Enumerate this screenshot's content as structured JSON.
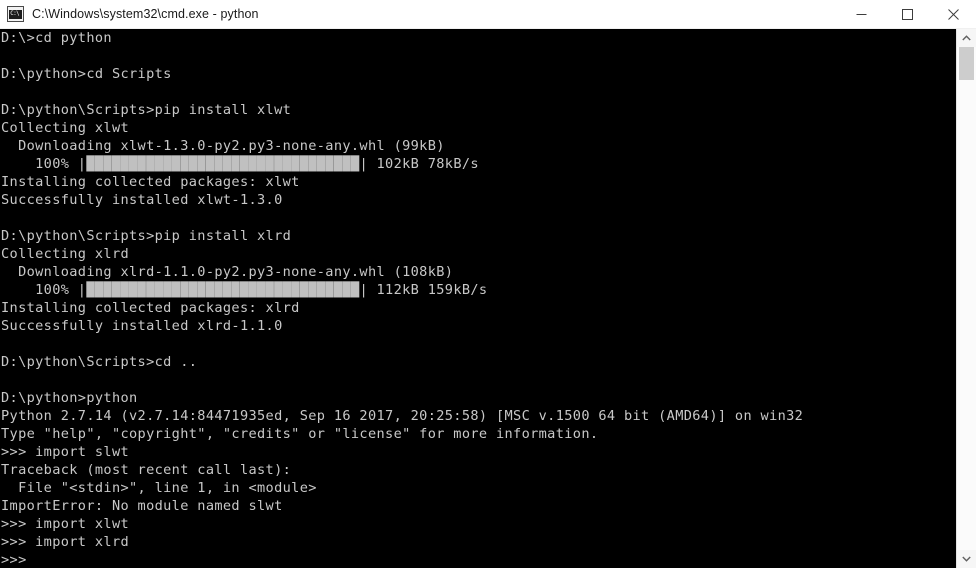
{
  "window": {
    "title": "C:\\Windows\\system32\\cmd.exe - python",
    "icon_name": "cmd-exe-icon",
    "icon_text": "C:\\",
    "titlebar_bg": "#ffffff",
    "console_bg": "#000000",
    "console_fg": "#c8c8c8",
    "controls": {
      "minimize_label": "Minimize",
      "maximize_label": "Maximize",
      "close_label": "Close"
    }
  },
  "scrollbar": {
    "up_arrow_label": "Scroll up",
    "down_arrow_label": "Scroll down",
    "thumb_label": "Scroll thumb"
  },
  "console": {
    "lines": [
      {
        "id": "l01",
        "text": "D:\\>cd python"
      },
      {
        "id": "l02",
        "text": ""
      },
      {
        "id": "l03",
        "text": "D:\\python>cd Scripts"
      },
      {
        "id": "l04",
        "text": ""
      },
      {
        "id": "l05",
        "text": "D:\\python\\Scripts>pip install xlwt"
      },
      {
        "id": "l06",
        "text": "Collecting xlwt"
      },
      {
        "id": "l07",
        "text": "  Downloading xlwt-1.3.0-py2.py3-none-any.whl (99kB)"
      },
      {
        "id": "l08",
        "type": "progress",
        "prefix": "    100% |",
        "blocks": "████████████████████████████████",
        "suffix": "| 102kB 78kB/s"
      },
      {
        "id": "l09",
        "text": "Installing collected packages: xlwt"
      },
      {
        "id": "l10",
        "text": "Successfully installed xlwt-1.3.0"
      },
      {
        "id": "l11",
        "text": ""
      },
      {
        "id": "l12",
        "text": "D:\\python\\Scripts>pip install xlrd"
      },
      {
        "id": "l13",
        "text": "Collecting xlrd"
      },
      {
        "id": "l14",
        "text": "  Downloading xlrd-1.1.0-py2.py3-none-any.whl (108kB)"
      },
      {
        "id": "l15",
        "type": "progress",
        "prefix": "    100% |",
        "blocks": "████████████████████████████████",
        "suffix": "| 112kB 159kB/s"
      },
      {
        "id": "l16",
        "text": "Installing collected packages: xlrd"
      },
      {
        "id": "l17",
        "text": "Successfully installed xlrd-1.1.0"
      },
      {
        "id": "l18",
        "text": ""
      },
      {
        "id": "l19",
        "text": "D:\\python\\Scripts>cd .."
      },
      {
        "id": "l20",
        "text": ""
      },
      {
        "id": "l21",
        "text": "D:\\python>python"
      },
      {
        "id": "l22",
        "text": "Python 2.7.14 (v2.7.14:84471935ed, Sep 16 2017, 20:25:58) [MSC v.1500 64 bit (AMD64)] on win32"
      },
      {
        "id": "l23",
        "text": "Type \"help\", \"copyright\", \"credits\" or \"license\" for more information."
      },
      {
        "id": "l24",
        "text": ">>> import slwt"
      },
      {
        "id": "l25",
        "text": "Traceback (most recent call last):"
      },
      {
        "id": "l26",
        "text": "  File \"<stdin>\", line 1, in <module>"
      },
      {
        "id": "l27",
        "text": "ImportError: No module named slwt"
      },
      {
        "id": "l28",
        "text": ">>> import xlwt"
      },
      {
        "id": "l29",
        "text": ">>> import xlrd"
      },
      {
        "id": "l30",
        "text": ">>>"
      }
    ]
  }
}
